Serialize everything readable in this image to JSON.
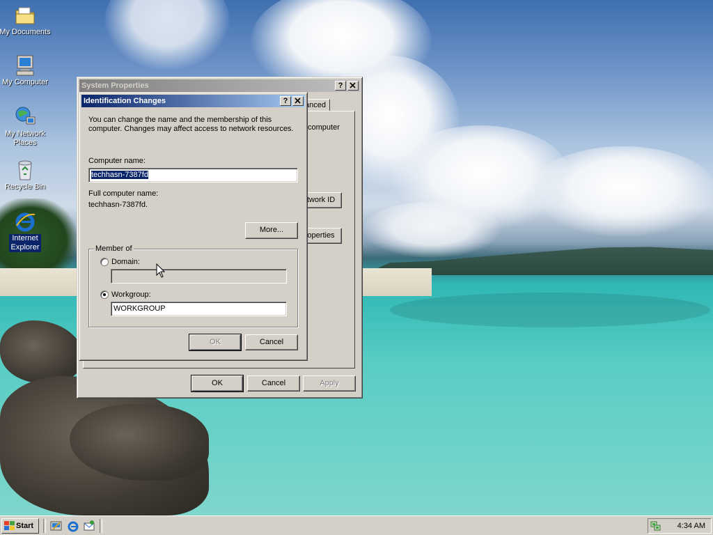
{
  "desktop": {
    "icons": [
      {
        "label": "My Documents",
        "icon": "my-documents-icon"
      },
      {
        "label": "My Computer",
        "icon": "my-computer-icon"
      },
      {
        "label": "My Network Places",
        "icon": "my-network-places-icon"
      },
      {
        "label": "Recycle Bin",
        "icon": "recycle-bin-icon"
      },
      {
        "label": "Internet Explorer",
        "icon": "internet-explorer-icon"
      }
    ]
  },
  "system_properties": {
    "title": "System Properties",
    "help_btn": "?",
    "close_btn": "x",
    "tab_partial": "anced",
    "text_partial_computer": "computer",
    "network_id_partial": "twork ID",
    "properties_partial": "operties",
    "ok": "OK",
    "cancel": "Cancel",
    "apply": "Apply"
  },
  "identification_changes": {
    "title": "Identification Changes",
    "help_btn": "?",
    "close_btn": "x",
    "description": "You can change the name and the membership of this computer. Changes may affect access to network resources.",
    "computer_name_label": "Computer name:",
    "computer_name_value": "techhasn-7387fd",
    "full_name_label": "Full computer name:",
    "full_name_value": "techhasn-7387fd.",
    "more_button": "More...",
    "member_of_label": "Member of",
    "domain_label": "Domain:",
    "domain_value": "",
    "workgroup_label": "Workgroup:",
    "workgroup_value": "WORKGROUP",
    "selected_option": "Workgroup",
    "ok": "OK",
    "cancel": "Cancel"
  },
  "taskbar": {
    "start_label": "Start",
    "quick_launch": [
      "show-desktop-icon",
      "internet-explorer-icon",
      "outlook-express-icon"
    ],
    "clock": "4:34 AM"
  },
  "colors": {
    "titlebar_active": "#0a246a",
    "face": "#d4d0c8",
    "selection": "#0a246a"
  }
}
